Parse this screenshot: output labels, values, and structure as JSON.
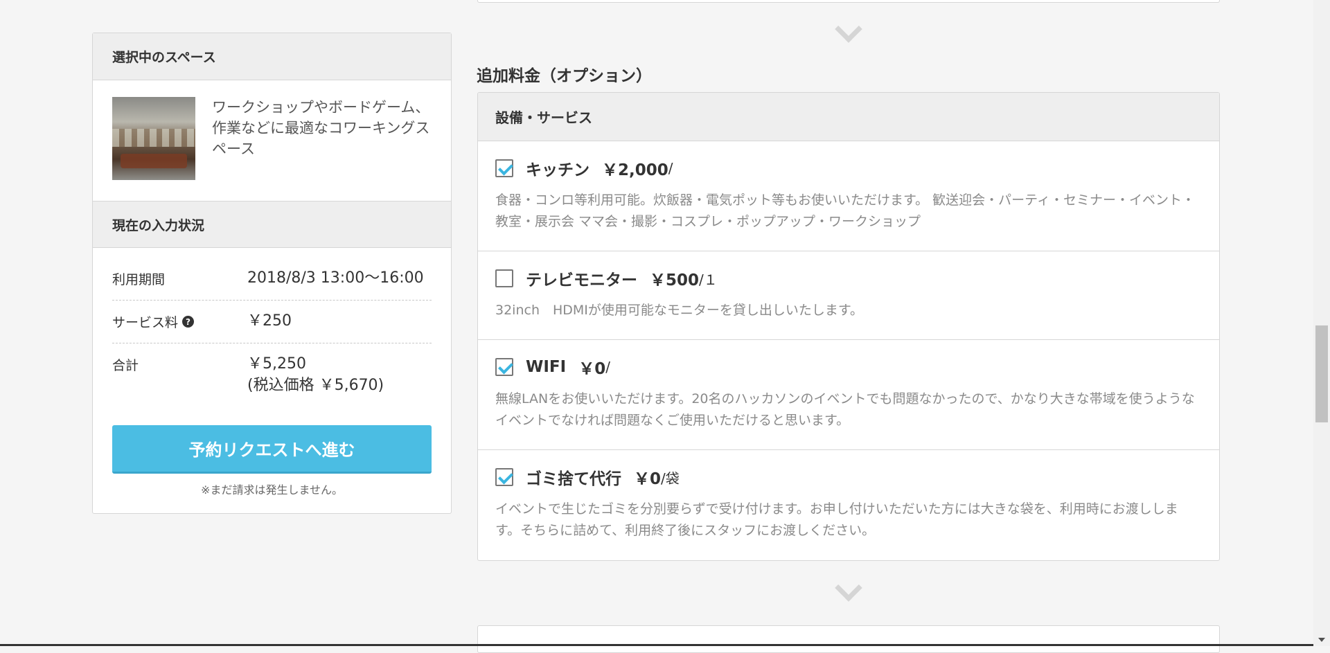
{
  "sidebar": {
    "space_heading": "選択中のスペース",
    "space_description": "ワークショップやボードゲーム、作業などに最適なコワーキングスペース",
    "status_heading": "現在の入力状況",
    "rows": [
      {
        "label": "利用期間",
        "value": "2018/8/3 13:00～16:00"
      },
      {
        "label": "サービス料",
        "value": "￥250"
      },
      {
        "label": "合計",
        "value": "￥5,250",
        "sub_value": "(税込価格 ￥5,670)"
      }
    ],
    "cta_label": "予約リクエストへ進む",
    "cta_note": "※まだ請求は発生しません。"
  },
  "options": {
    "title": "追加料金（オプション）",
    "section_heading": "設備・サービス",
    "items": [
      {
        "name": "キッチン",
        "price": "￥2,000",
        "unit": "/",
        "checked": true,
        "description": "食器・コンロ等利用可能。炊飯器・電気ポット等もお使いいただけます。 歓送迎会・パーティ・セミナー・イベント・教室・展示会 ママ会・撮影・コスプレ・ポップアップ・ワークショップ"
      },
      {
        "name": "テレビモニター",
        "price": "￥500",
        "unit": "/１",
        "checked": false,
        "description": "32inch　HDMIが使用可能なモニターを貸し出しいたします。"
      },
      {
        "name": "WIFI",
        "price": "￥0",
        "unit": "/",
        "checked": true,
        "description": "無線LANをお使いいただけます。20名のハッカソンのイベントでも問題なかったので、かなり大きな帯域を使うようなイベントでなければ問題なくご使用いただけると思います。"
      },
      {
        "name": "ゴミ捨て代行",
        "price": "￥0",
        "unit": "/袋",
        "checked": true,
        "description": "イベントで生じたゴミを分別要らずで受け付けます。お申し付けいただいた方には大きな袋を、利用時にお渡しします。そちらに詰めて、利用終了後にスタッフにお渡しください。"
      }
    ]
  },
  "colors": {
    "accent": "#4bbde3",
    "check": "#3ab5e0",
    "background": "#f5f5f5"
  }
}
